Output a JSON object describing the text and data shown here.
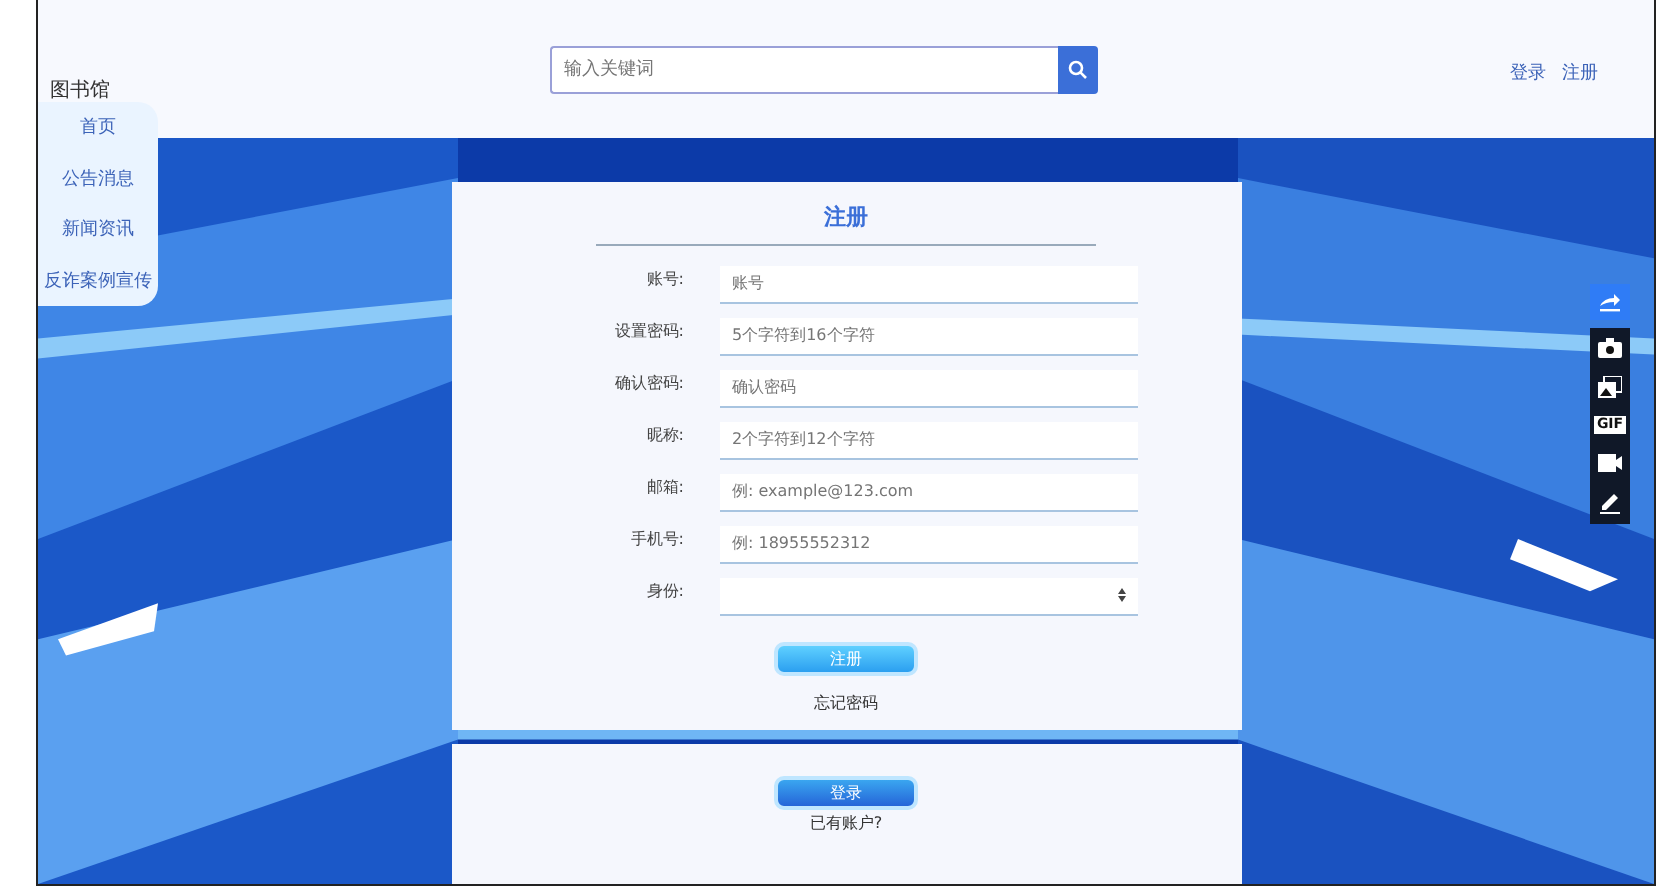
{
  "header": {
    "logo": "图书馆",
    "search": {
      "placeholder": "输入关键词"
    },
    "links": [
      "登录",
      "注册"
    ]
  },
  "menu": [
    {
      "label": "首页"
    },
    {
      "label": "公告消息"
    },
    {
      "label": "新闻资讯"
    },
    {
      "label": "反诈案例宣传"
    }
  ],
  "register_form": {
    "title": "注册",
    "fields": [
      {
        "label": "账号:",
        "kind": "input",
        "placeholder": "账号"
      },
      {
        "label": "设置密码:",
        "kind": "input",
        "placeholder": "5个字符到16个字符"
      },
      {
        "label": "确认密码:",
        "kind": "input",
        "placeholder": "确认密码"
      },
      {
        "label": "昵称:",
        "kind": "input",
        "placeholder": "2个字符到12个字符"
      },
      {
        "label": "邮箱:",
        "kind": "input",
        "placeholder": "例: example@123.com"
      },
      {
        "label": "手机号:",
        "kind": "input",
        "placeholder": "例: 18955552312"
      },
      {
        "label": "身份:",
        "kind": "select"
      }
    ],
    "submit": "注册",
    "forgot": "忘记密码"
  },
  "login_card": {
    "button": "登录",
    "hint": "已有账户?"
  },
  "capture_toolbar": {
    "gif_label": "GIF"
  }
}
